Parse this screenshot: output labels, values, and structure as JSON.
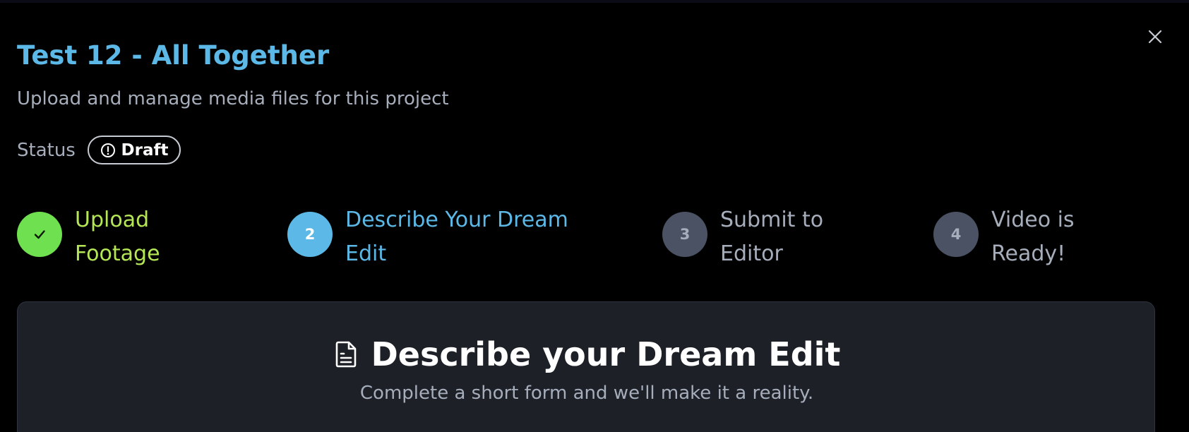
{
  "project": {
    "title": "Test 12 - All Together",
    "subtitle": "Upload and manage media files for this project"
  },
  "status": {
    "label": "Status",
    "badge_text": "Draft",
    "badge_icon": "alert-circle-icon"
  },
  "close_icon": "close-icon",
  "steps": [
    {
      "number": "",
      "label": "Upload\nFootage",
      "state": "complete",
      "icon": "check-icon",
      "circle_color": "#6fe04f",
      "label_color": "#b5e655"
    },
    {
      "number": "2",
      "label": "Describe Your Dream\nEdit",
      "state": "active",
      "circle_color": "#5cb8e6",
      "label_color": "#5cb8e6"
    },
    {
      "number": "3",
      "label": "Submit to\nEditor",
      "state": "pending",
      "circle_color": "#4b5263",
      "label_color": "#a6adbb"
    },
    {
      "number": "4",
      "label": "Video is\nReady!",
      "state": "pending",
      "circle_color": "#4b5263",
      "label_color": "#a6adbb"
    }
  ],
  "card": {
    "icon": "document-icon",
    "title": "Describe your Dream Edit",
    "subtitle": "Complete a short form and we'll make it a reality."
  }
}
